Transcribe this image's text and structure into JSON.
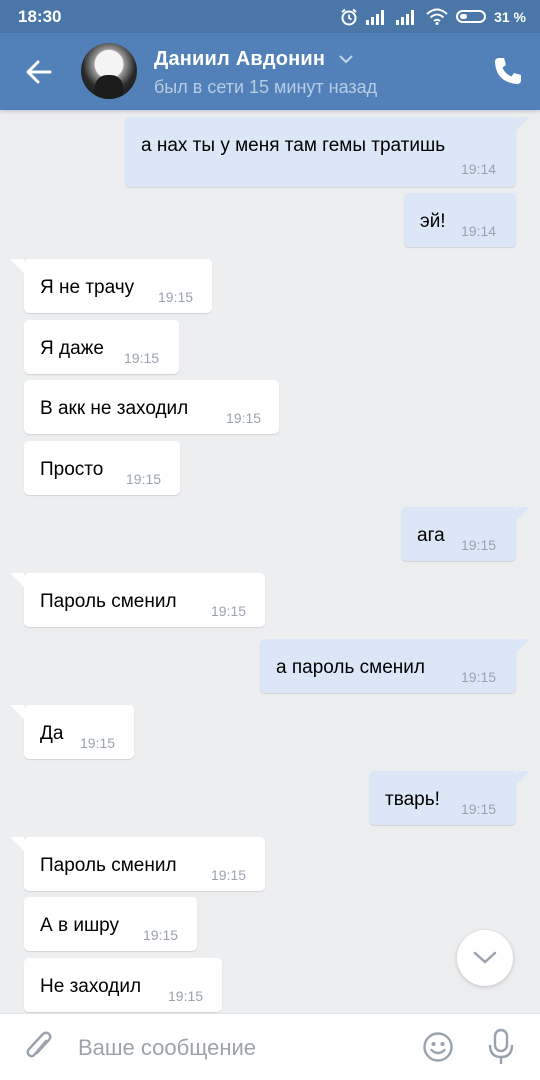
{
  "status_bar": {
    "time": "18:30",
    "battery": "31 %",
    "icons": [
      "alarm-icon",
      "signal-icon",
      "signal-icon",
      "wifi-icon",
      "battery-icon"
    ]
  },
  "header": {
    "contact_name": "Даниил Авдонин",
    "contact_status": "был в сети 15 минут назад",
    "icons": [
      "back-arrow-icon",
      "chevron-down-icon",
      "phone-icon"
    ]
  },
  "colors": {
    "header": "#5181b8",
    "status_bar": "#4a76a8",
    "background": "#edeef0",
    "incoming_bubble": "#ffffff",
    "outgoing_bubble": "#dbe7f6"
  },
  "messages": [
    {
      "direction": "out",
      "text": "а нах ты у меня там гемы тратишь",
      "time": "19:14"
    },
    {
      "direction": "out",
      "text": "эй!",
      "time": "19:14"
    },
    {
      "direction": "in",
      "text": "Я не трачу",
      "time": "19:15"
    },
    {
      "direction": "in",
      "text": "Я даже",
      "time": "19:15"
    },
    {
      "direction": "in",
      "text": "В акк не заходил",
      "time": "19:15"
    },
    {
      "direction": "in",
      "text": "Просто",
      "time": "19:15"
    },
    {
      "direction": "out",
      "text": "ага",
      "time": "19:15"
    },
    {
      "direction": "in",
      "text": "Пароль сменил",
      "time": "19:15"
    },
    {
      "direction": "out",
      "text": "а пароль сменил",
      "time": "19:15"
    },
    {
      "direction": "in",
      "text": "Да",
      "time": "19:15"
    },
    {
      "direction": "out",
      "text": "тварь!",
      "time": "19:15"
    },
    {
      "direction": "in",
      "text": "Пароль сменил",
      "time": "19:15"
    },
    {
      "direction": "in",
      "text": "А в ишру",
      "time": "19:15"
    },
    {
      "direction": "in",
      "text": "Не заходил",
      "time": "19:15"
    }
  ],
  "composer": {
    "placeholder": "Ваше сообщение",
    "icons": [
      "paperclip-icon",
      "emoji-icon",
      "microphone-icon"
    ]
  },
  "scroll_button_icon": "chevron-down-icon"
}
